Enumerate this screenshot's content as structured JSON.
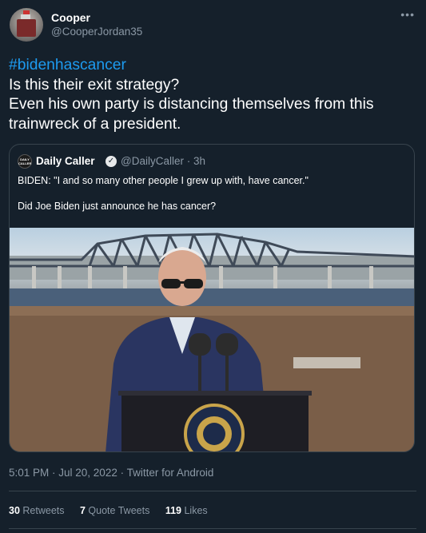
{
  "author": {
    "name": "Cooper",
    "handle": "@CooperJordan35",
    "more_icon": "more-dots-icon"
  },
  "tweet": {
    "hashtag": "#bidenhascancer",
    "lines": [
      "Is this their exit strategy?",
      "Even his own party is distancing themselves from this",
      "trainwreck of a president."
    ]
  },
  "quote": {
    "logo_text": "DAILY CALLER",
    "name": "Daily Caller",
    "verified_icon": "verified-badge-icon",
    "handle_time": "@DailyCaller · 3h",
    "text1": "BIDEN: \"I and so many other people I grew up with, have cancer.\"",
    "text2": "Did Joe Biden just announce he has cancer?",
    "media_alt": "photo-man-at-podium-with-microphones"
  },
  "meta": {
    "timestamp": "5:01 PM · Jul 20, 2022 · Twitter for Android"
  },
  "stats": {
    "retweets_count": "30",
    "retweets_label": "Retweets",
    "quotes_count": "7",
    "quotes_label": "Quote Tweets",
    "likes_count": "119",
    "likes_label": "Likes"
  },
  "colors": {
    "background": "#15202b",
    "accent": "#1d9bf0",
    "muted": "#8b98a5",
    "border": "#38444d"
  }
}
